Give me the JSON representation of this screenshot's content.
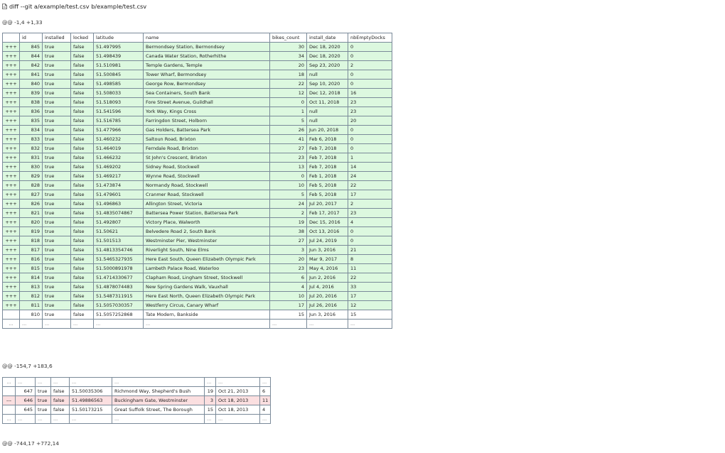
{
  "file_header": {
    "icon": "file-icon",
    "title": "diff --git a/example/test.csv b/example/test.csv"
  },
  "hunks": [
    {
      "header": "@@ -1,4 +1,33",
      "columns": [
        "",
        "id",
        "installed",
        "locked",
        "latitude",
        "name",
        "bikes_count",
        "install_date",
        "nbEmptyDocks"
      ],
      "rows": [
        {
          "type": "add",
          "cells": [
            "+++",
            "845",
            "true",
            "false",
            "51.497995",
            "Bermondsey Station, Bermondsey",
            "30",
            "Dec 18, 2020",
            "0"
          ]
        },
        {
          "type": "add",
          "cells": [
            "+++",
            "844",
            "true",
            "false",
            "51.498439",
            "Canada Water Station, Rotherhithe",
            "34",
            "Dec 18, 2020",
            "0"
          ]
        },
        {
          "type": "add",
          "cells": [
            "+++",
            "842",
            "true",
            "false",
            "51.510981",
            "Temple Gardens, Temple",
            "20",
            "Sep 23, 2020",
            "2"
          ]
        },
        {
          "type": "add",
          "cells": [
            "+++",
            "841",
            "true",
            "false",
            "51.500845",
            "Tower Wharf, Bermondsey",
            "18",
            "null",
            "0"
          ]
        },
        {
          "type": "add",
          "cells": [
            "+++",
            "840",
            "true",
            "false",
            "51.498585",
            "George Row, Bermondsey",
            "22",
            "Sep 10, 2020",
            "0"
          ]
        },
        {
          "type": "add",
          "cells": [
            "+++",
            "839",
            "true",
            "false",
            "51.508033",
            "Sea Containers, South Bank",
            "12",
            "Dec 12, 2018",
            "16"
          ]
        },
        {
          "type": "add",
          "cells": [
            "+++",
            "838",
            "true",
            "false",
            "51.518093",
            "Fore Street Avenue, Guildhall",
            "0",
            "Oct 11, 2018",
            "23"
          ]
        },
        {
          "type": "add",
          "cells": [
            "+++",
            "836",
            "true",
            "false",
            "51.541596",
            "York Way, Kings Cross",
            "1",
            "null",
            "23"
          ]
        },
        {
          "type": "add",
          "cells": [
            "+++",
            "835",
            "true",
            "false",
            "51.516785",
            "Farringdon Street, Holborn",
            "5",
            "null",
            "20"
          ]
        },
        {
          "type": "add",
          "cells": [
            "+++",
            "834",
            "true",
            "false",
            "51.477966",
            "Gas Holders, Battersea Park",
            "26",
            "Jun 20, 2018",
            "0"
          ]
        },
        {
          "type": "add",
          "cells": [
            "+++",
            "833",
            "true",
            "false",
            "51.460232",
            "Saltoun Road, Brixton",
            "41",
            "Feb 6, 2018",
            "0"
          ]
        },
        {
          "type": "add",
          "cells": [
            "+++",
            "832",
            "true",
            "false",
            "51.464019",
            "Ferndale Road, Brixton",
            "27",
            "Feb 7, 2018",
            "0"
          ]
        },
        {
          "type": "add",
          "cells": [
            "+++",
            "831",
            "true",
            "false",
            "51.466232",
            "St John's Crescent, Brixton",
            "23",
            "Feb 7, 2018",
            "1"
          ]
        },
        {
          "type": "add",
          "cells": [
            "+++",
            "830",
            "true",
            "false",
            "51.469202",
            "Sidney Road, Stockwell",
            "13",
            "Feb 7, 2018",
            "14"
          ]
        },
        {
          "type": "add",
          "cells": [
            "+++",
            "829",
            "true",
            "false",
            "51.469217",
            "Wynne Road, Stockwell",
            "0",
            "Feb 1, 2018",
            "24"
          ]
        },
        {
          "type": "add",
          "cells": [
            "+++",
            "828",
            "true",
            "false",
            "51.473874",
            "Normandy Road, Stockwell",
            "10",
            "Feb 5, 2018",
            "22"
          ]
        },
        {
          "type": "add",
          "cells": [
            "+++",
            "827",
            "true",
            "false",
            "51.479601",
            "Cranmer Road, Stockwell",
            "5",
            "Feb 5, 2018",
            "17"
          ]
        },
        {
          "type": "add",
          "cells": [
            "+++",
            "826",
            "true",
            "false",
            "51.496863",
            "Allington Street, Victoria",
            "24",
            "Jul 20, 2017",
            "2"
          ]
        },
        {
          "type": "add",
          "cells": [
            "+++",
            "821",
            "true",
            "false",
            "51.4835074867",
            "Battersea Power Station, Battersea Park",
            "2",
            "Feb 17, 2017",
            "23"
          ]
        },
        {
          "type": "add",
          "cells": [
            "+++",
            "820",
            "true",
            "false",
            "51.492807",
            "Victory Place, Walworth",
            "19",
            "Dec 15, 2016",
            "4"
          ]
        },
        {
          "type": "add",
          "cells": [
            "+++",
            "819",
            "true",
            "false",
            "51.50621",
            "Belvedere Road 2, South Bank",
            "38",
            "Oct 13, 2016",
            "0"
          ]
        },
        {
          "type": "add",
          "cells": [
            "+++",
            "818",
            "true",
            "false",
            "51.501513",
            "Westminster Pier, Westminster",
            "27",
            "Jul 24, 2019",
            "0"
          ]
        },
        {
          "type": "add",
          "cells": [
            "+++",
            "817",
            "true",
            "false",
            "51.4813354746",
            "Riverlight South, Nine Elms",
            "3",
            "Jun 3, 2016",
            "21"
          ]
        },
        {
          "type": "add",
          "cells": [
            "+++",
            "816",
            "true",
            "false",
            "51.5465327935",
            "Here East South, Queen Elizabeth Olympic Park",
            "20",
            "Mar 9, 2017",
            "8"
          ]
        },
        {
          "type": "add",
          "cells": [
            "+++",
            "815",
            "true",
            "false",
            "51.5000891978",
            "Lambeth Palace Road, Waterloo",
            "23",
            "May 4, 2016",
            "11"
          ]
        },
        {
          "type": "add",
          "cells": [
            "+++",
            "814",
            "true",
            "false",
            "51.4714330677",
            "Clapham Road, Lingham Street, Stockwell",
            "6",
            "Jun 2, 2016",
            "22"
          ]
        },
        {
          "type": "add",
          "cells": [
            "+++",
            "813",
            "true",
            "false",
            "51.4878074483",
            "New Spring Gardens Walk, Vauxhall",
            "4",
            "Jul 4, 2016",
            "33"
          ]
        },
        {
          "type": "add",
          "cells": [
            "+++",
            "812",
            "true",
            "false",
            "51.5487311915",
            "Here East North, Queen Elizabeth Olympic Park",
            "10",
            "Jul 20, 2016",
            "17"
          ]
        },
        {
          "type": "add",
          "cells": [
            "+++",
            "811",
            "true",
            "false",
            "51.5057030357",
            "Westferry Circus, Canary Wharf",
            "17",
            "Jul 26, 2016",
            "12"
          ]
        },
        {
          "type": "ctx",
          "cells": [
            "",
            "810",
            "true",
            "false",
            "51.5057252868",
            "Tate Modern, Bankside",
            "15",
            "Jun 3, 2016",
            "15"
          ]
        },
        {
          "type": "ell",
          "cells": [
            "...",
            "...",
            "...",
            "...",
            "...",
            "...",
            "...",
            "...",
            "..."
          ]
        }
      ]
    },
    {
      "header": "@@ -154,7 +183,6",
      "rows": [
        {
          "type": "ell",
          "cells": [
            "...",
            "...",
            "...",
            "...",
            "...",
            "...",
            "...",
            "...",
            "..."
          ]
        },
        {
          "type": "ctx",
          "cells": [
            "",
            "647",
            "true",
            "false",
            "51.50035306",
            "Richmond Way, Shepherd's Bush",
            "19",
            "Oct 21, 2013",
            "6"
          ]
        },
        {
          "type": "del",
          "cells": [
            "---",
            "646",
            "true",
            "false",
            "51.49886563",
            "Buckingham Gate, Westminster",
            "3",
            "Oct 18, 2013",
            "11"
          ]
        },
        {
          "type": "ctx",
          "cells": [
            "",
            "645",
            "true",
            "false",
            "51.50173215",
            "Great Suffolk Street, The Borough",
            "15",
            "Oct 18, 2013",
            "4"
          ]
        },
        {
          "type": "ell",
          "cells": [
            "...",
            "...",
            "...",
            "...",
            "...",
            "...",
            "...",
            "...",
            "..."
          ]
        }
      ]
    },
    {
      "header": "@@ -744,17 +772,14"
    }
  ]
}
